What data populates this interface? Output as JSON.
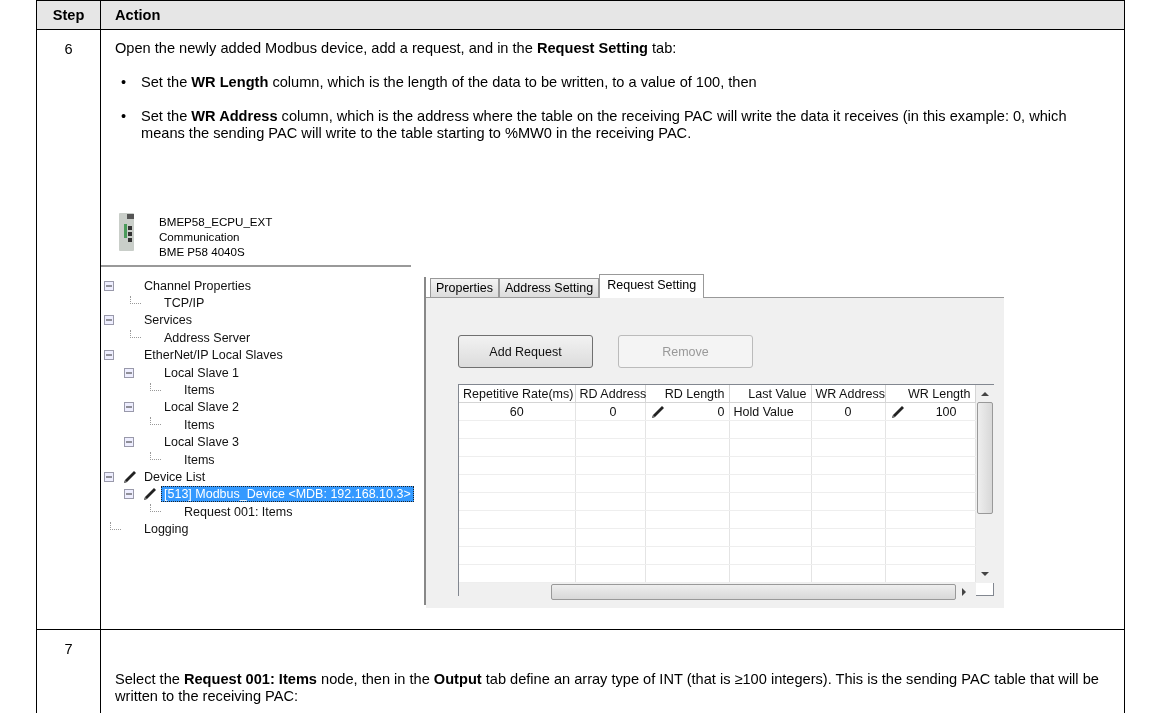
{
  "table": {
    "columns": [
      "Step",
      "Action"
    ],
    "rows": [
      {
        "step": "6",
        "intro": "Open the newly added Modbus device, add a request, and in the **Request Setting** tab:",
        "bullets": [
          {
            "marker": "•",
            "text": "Set the **WR Length** column, which is the length of the data to be written, to a value of 100, then"
          },
          {
            "marker": "•",
            "text": "Set the **WR Address** column, which is the address where the table on the receiving PAC will write the data it receives (in this example: 0, which means the sending PAC will write to the table starting to %MW0 in the receiving PAC."
          }
        ],
        "figure": {
          "device": {
            "name": "BMEP58_ECPU_EXT",
            "family": "Communication",
            "reference": "BME P58 4040S"
          },
          "tree": [
            {
              "label": "Channel Properties",
              "expanded": true,
              "edited": false,
              "selected": false,
              "children": [
                {
                  "label": "TCP/IP",
                  "edited": false,
                  "selected": false
                }
              ]
            },
            {
              "label": "Services",
              "expanded": true,
              "edited": false,
              "selected": false,
              "children": [
                {
                  "label": "Address Server",
                  "edited": false,
                  "selected": false
                }
              ]
            },
            {
              "label": "EtherNet/IP Local Slaves",
              "expanded": true,
              "edited": false,
              "selected": false,
              "children": [
                {
                  "label": "Local Slave 1",
                  "expanded": true,
                  "edited": false,
                  "selected": false,
                  "children": [
                    {
                      "label": "Items",
                      "edited": false,
                      "selected": false
                    }
                  ]
                },
                {
                  "label": "Local Slave 2",
                  "expanded": true,
                  "edited": false,
                  "selected": false,
                  "children": [
                    {
                      "label": "Items",
                      "edited": false,
                      "selected": false
                    }
                  ]
                },
                {
                  "label": "Local Slave 3",
                  "expanded": true,
                  "edited": false,
                  "selected": false,
                  "children": [
                    {
                      "label": "Items",
                      "edited": false,
                      "selected": false
                    }
                  ]
                }
              ]
            },
            {
              "label": "Device List",
              "expanded": true,
              "edited": true,
              "selected": false,
              "children": [
                {
                  "label": "[513] Modbus_Device <MDB: 192.168.10.3>",
                  "expanded": true,
                  "edited": true,
                  "selected": true,
                  "children": [
                    {
                      "label": "Request 001: Items",
                      "edited": false,
                      "selected": false
                    }
                  ]
                }
              ]
            },
            {
              "label": "Logging",
              "edited": false,
              "selected": false
            }
          ],
          "tabs": [
            {
              "label": "Properties",
              "selected": false
            },
            {
              "label": "Address Setting",
              "selected": false
            },
            {
              "label": "Request Setting",
              "selected": true
            }
          ],
          "buttons": [
            {
              "label": "Add Request",
              "disabled": false
            },
            {
              "label": "Remove",
              "disabled": true
            }
          ],
          "grid": {
            "columns": [
              "Repetitive Rate(ms)",
              "RD Address",
              "RD Length",
              "Last Value",
              "WR Address",
              "WR Length"
            ],
            "rows": [
              [
                {
                  "text": "60",
                  "edited": false
                },
                {
                  "text": "0",
                  "edited": false
                },
                {
                  "text": "0",
                  "edited": true
                },
                {
                  "text": "Hold Value",
                  "edited": false
                },
                {
                  "text": "0",
                  "edited": false
                },
                {
                  "text": "100",
                  "edited": true
                }
              ]
            ]
          }
        }
      },
      {
        "step": "7",
        "text": "Select the **Request 001: Items** node, then in the **Output** tab define an array type of INT (that is ≥100 integers). This is the sending PAC table that will be written to the receiving PAC:"
      }
    ]
  }
}
